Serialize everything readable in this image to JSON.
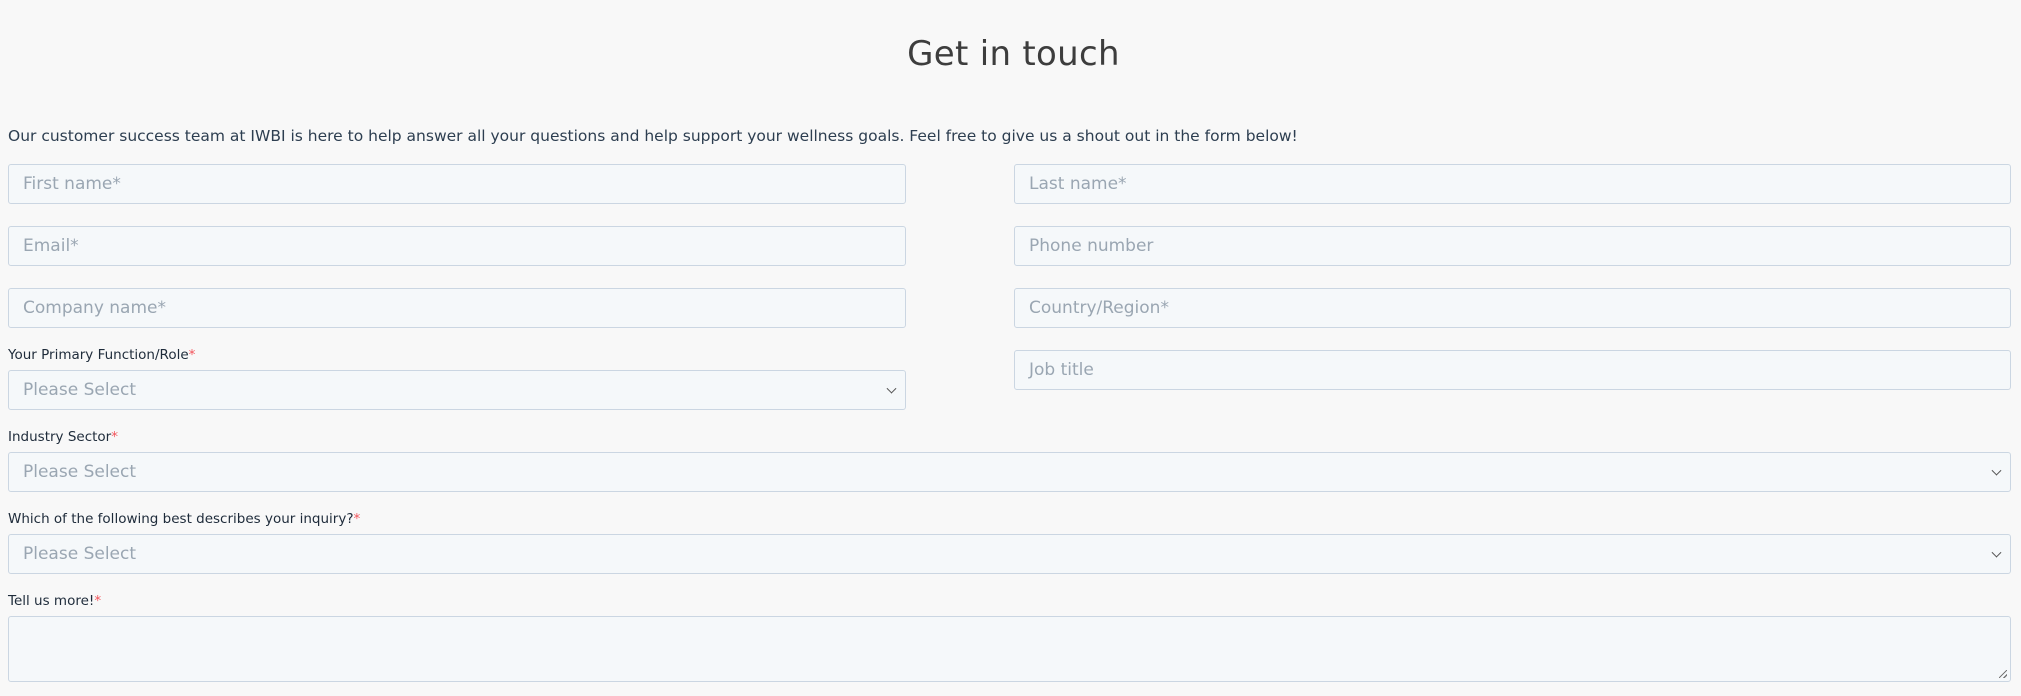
{
  "form": {
    "title": "Get in touch",
    "intro": "Our customer success team at IWBI is here to help answer all your questions and help support your wellness goals. Feel free to give us a shout out in the form below!",
    "first_name_placeholder": "First name*",
    "last_name_placeholder": "Last name*",
    "email_placeholder": "Email*",
    "phone_placeholder": "Phone number",
    "company_placeholder": "Company name*",
    "country_placeholder": "Country/Region*",
    "job_title_placeholder": "Job title",
    "role_label": "Your Primary Function/Role",
    "role_value": "Please Select",
    "industry_label": "Industry Sector",
    "industry_value": "Please Select",
    "inquiry_label": "Which of the following best describes your inquiry?",
    "inquiry_value": "Please Select",
    "more_label": "Tell us more!",
    "required_mark": "*"
  },
  "colors": {
    "background": "#f8f8f8",
    "field_bg": "#f5f8fa",
    "field_border": "#cbd6e2",
    "required": "#f2545b"
  },
  "icons": [
    "chevron-down-icon",
    "resize-grip-icon"
  ]
}
